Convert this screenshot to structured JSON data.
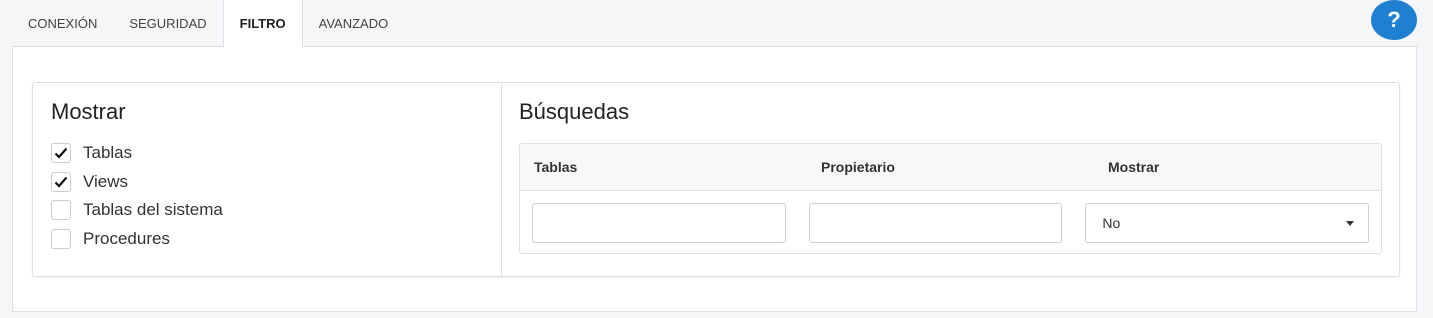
{
  "tabs": [
    {
      "label": "CONEXIÓN"
    },
    {
      "label": "SEGURIDAD"
    },
    {
      "label": "FILTRO"
    },
    {
      "label": "AVANZADO"
    }
  ],
  "active_tab": "FILTRO",
  "help": {
    "icon": "help-icon",
    "glyph": "?",
    "color": "#1f7fd1"
  },
  "show_section": {
    "title": "Mostrar",
    "options": [
      {
        "label": "Tablas",
        "checked": true
      },
      {
        "label": "Views",
        "checked": true
      },
      {
        "label": "Tablas del sistema",
        "checked": false
      },
      {
        "label": "Procedures",
        "checked": false
      }
    ]
  },
  "search_section": {
    "title": "Búsquedas",
    "columns": [
      "Tablas",
      "Propietario",
      "Mostrar"
    ],
    "inputs": {
      "tablas": "",
      "propietario": "",
      "mostrar_selected": "No"
    }
  }
}
